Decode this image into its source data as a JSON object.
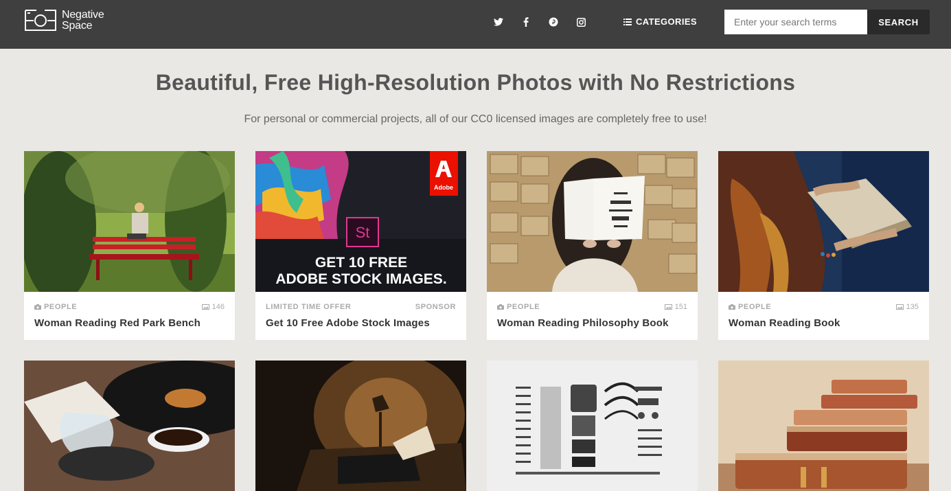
{
  "header": {
    "logo_line1": "Negative",
    "logo_line2": "Space",
    "social": [
      "twitter-icon",
      "facebook-icon",
      "pinterest-icon",
      "instagram-icon"
    ],
    "categories_label": "CATEGORIES",
    "search_placeholder": "Enter your search terms",
    "search_button": "SEARCH"
  },
  "hero": {
    "title": "Beautiful, Free High-Resolution Photos with No Restrictions",
    "subtitle": "For personal or commercial projects, all of our CC0 licensed images are completely free to use!"
  },
  "cards": [
    {
      "category": "PEOPLE",
      "count": "146",
      "title": "Woman Reading Red Park Bench"
    },
    {
      "category": "LIMITED TIME OFFER",
      "sponsor": "SPONSOR",
      "title": "Get 10 Free Adobe Stock Images",
      "ad_line1": "GET 10 FREE",
      "ad_line2": "ADOBE STOCK IMAGES.",
      "ad_badge": "St",
      "ad_brand": "Adobe"
    },
    {
      "category": "PEOPLE",
      "count": "151",
      "title": "Woman Reading Philosophy Book"
    },
    {
      "category": "PEOPLE",
      "count": "135",
      "title": "Woman Reading Book"
    }
  ],
  "colors": {
    "header_bg": "#3f3f3f",
    "page_bg": "#e9e8e4",
    "search_button_bg": "#2a2a2a",
    "adobe_red": "#eb1000"
  }
}
